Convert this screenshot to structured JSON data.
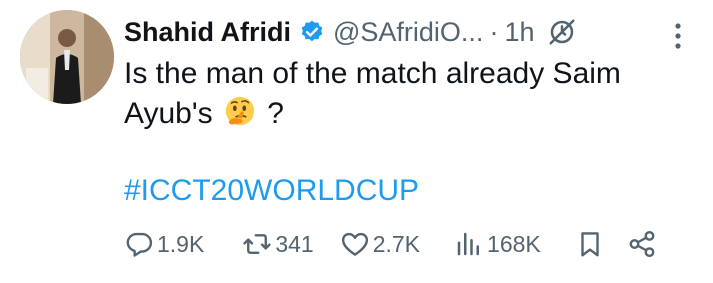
{
  "tweet": {
    "author_name": "Shahid Afridi",
    "handle": "@SAfridiO...",
    "separator": "·",
    "time": "1h",
    "text_before_emoji": "Is the man of the match already Saim Ayub's",
    "text_after_emoji": "?",
    "emoji": "thinking-face",
    "hashtag": "#ICCT20WORLDCUP"
  },
  "actions": {
    "replies": "1.9K",
    "reposts": "341",
    "likes": "2.7K",
    "views": "168K"
  },
  "colors": {
    "text": "#0f1419",
    "muted": "#536471",
    "accent": "#1d9bf0"
  }
}
